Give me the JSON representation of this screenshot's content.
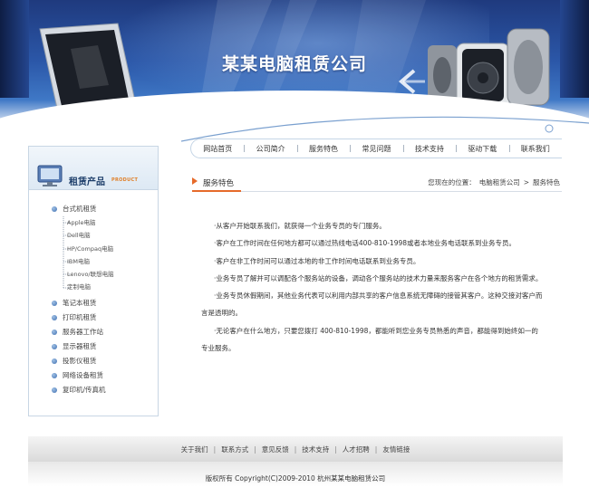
{
  "header": {
    "site_title": "某某电脑租赁公司"
  },
  "nav": {
    "items": [
      "网站首页",
      "公司简介",
      "服务特色",
      "常见问题",
      "技术支持",
      "驱动下载",
      "联系我们"
    ]
  },
  "sidebar": {
    "title": "租赁产品",
    "subtitle": "PRODUCT",
    "categories": [
      {
        "label": "台式机租赁",
        "subitems": [
          "Apple电脑",
          "Dell电脑",
          "HP/Compaq电脑",
          "IBM电脑",
          "Lenovo/联想电脑",
          "定制电脑"
        ]
      },
      {
        "label": "笔记本租赁"
      },
      {
        "label": "打印机租赁"
      },
      {
        "label": "服务器工作站"
      },
      {
        "label": "显示器租赁"
      },
      {
        "label": "投影仪租赁"
      },
      {
        "label": "网络设备租赁"
      },
      {
        "label": "复印机/传真机"
      }
    ]
  },
  "main": {
    "section_title": "服务特色",
    "location": {
      "prefix": "您现在的位置：",
      "home": "电脑租赁公司",
      "separator": ">",
      "current": "服务特色"
    },
    "paragraphs": [
      "·从客户开始联系我们，就获得一个业务专员的专门服务。",
      "·客户在工作时间在任何地方都可以通过热线电话400-810-1998或者本地业务电话联系到业务专员。",
      "·客户在非工作时间可以通过本地的非工作时间电话联系到业务专员。",
      "·业务专员了解并可以调配各个服务站的设备，调动各个服务站的技术力量来服务客户在各个地方的租赁需求。",
      "·业务专员休假期间，其他业务代表可以利用内部共享的客户信息系统无障碍的接管其客户。这种交接对客户而言是透明的。",
      "·无论客户在什么地方，只要您拨打 400-810-1998，都能听到您业务专员熟悉的声音，都能得到始终如一的专业服务。"
    ]
  },
  "footer": {
    "links": [
      "关于我们",
      "联系方式",
      "意见反馈",
      "技术支持",
      "人才招聘",
      "友情链接"
    ],
    "separator": "|",
    "copyright": "版权所有  Copyright(C)2009-2010 杭州某某电脑租赁公司"
  },
  "colors": {
    "banner_blue": "#2b57a8",
    "accent_orange": "#e66a2a",
    "title_navy": "#1d3e6a"
  }
}
